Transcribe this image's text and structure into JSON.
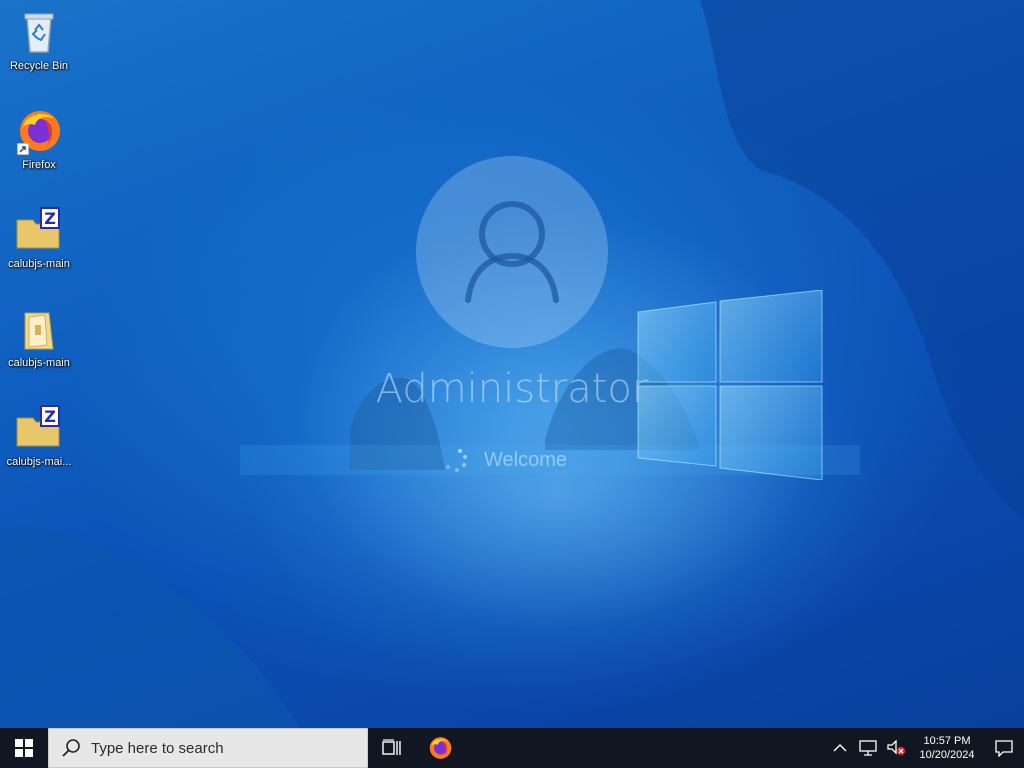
{
  "desktop": {
    "icons": [
      {
        "label": "Recycle Bin",
        "icon": "recycle-bin-icon"
      },
      {
        "label": "Firefox",
        "icon": "firefox-icon"
      },
      {
        "label": "calubjs-main",
        "icon": "zip-folder-icon"
      },
      {
        "label": "calubjs-main",
        "icon": "folder-icon"
      },
      {
        "label": "calubjs-mai...",
        "icon": "zip-folder-icon"
      }
    ]
  },
  "login": {
    "user_name": "Administrator",
    "status": "Welcome"
  },
  "taskbar": {
    "search_placeholder": "Type here to search",
    "pinned": [
      {
        "name": "task-view",
        "icon": "task-view-icon"
      },
      {
        "name": "firefox",
        "icon": "firefox-icon"
      }
    ],
    "clock": {
      "time": "10:57 PM",
      "date": "10/20/2024"
    }
  },
  "colors": {
    "taskbar_bg": "#101722",
    "search_bg": "#e7e7e7",
    "desktop_accent": "#0f5fc0"
  }
}
